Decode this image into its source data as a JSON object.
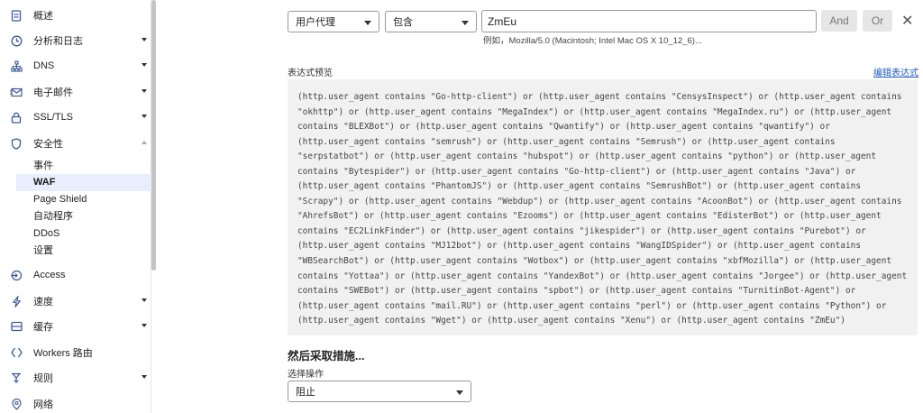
{
  "sidebar": {
    "items": [
      {
        "label": "概述",
        "icon": "document-icon"
      },
      {
        "label": "分析和日志",
        "icon": "clock-icon"
      },
      {
        "label": "DNS",
        "icon": "network-icon"
      },
      {
        "label": "电子邮件",
        "icon": "email-icon"
      },
      {
        "label": "SSL/TLS",
        "icon": "lock-icon"
      },
      {
        "label": "安全性",
        "icon": "shield-icon"
      },
      {
        "label": "Access",
        "icon": "access-icon"
      },
      {
        "label": "速度",
        "icon": "lightning-icon"
      },
      {
        "label": "缓存",
        "icon": "storage-icon"
      },
      {
        "label": "Workers 路由",
        "icon": "workers-icon"
      },
      {
        "label": "规则",
        "icon": "rules-icon"
      },
      {
        "label": "网络",
        "icon": "location-icon"
      }
    ],
    "security_sub": [
      "事件",
      "WAF",
      "Page Shield",
      "自动程序",
      "DDoS",
      "设置"
    ]
  },
  "rule": {
    "field": "用户代理",
    "operator": "包含",
    "value": "ZmEu",
    "and_label": "And",
    "or_label": "Or",
    "close_symbol": "✕",
    "example": "例如，Mozilla/5.0 (Macintosh; Intel Mac OS X 10_12_6)..."
  },
  "preview": {
    "label": "表达式预览",
    "edit_link": "编辑表达式",
    "expression": "(http.user_agent contains \"Go-http-client\") or (http.user_agent contains \"CensysInspect\") or (http.user_agent contains \"okhttp\") or (http.user_agent contains \"MegaIndex\") or (http.user_agent contains \"MegaIndex.ru\") or (http.user_agent contains \"BLEXBot\") or (http.user_agent contains \"Qwantify\") or (http.user_agent contains \"qwantify\") or (http.user_agent contains \"semrush\") or (http.user_agent contains \"Semrush\") or (http.user_agent contains \"serpstatbot\") or (http.user_agent contains \"hubspot\") or (http.user_agent contains \"python\") or (http.user_agent contains \"Bytespider\") or (http.user_agent contains \"Go-http-client\") or (http.user_agent contains \"Java\") or (http.user_agent contains \"PhantomJS\") or (http.user_agent contains \"SemrushBot\") or (http.user_agent contains \"Scrapy\") or (http.user_agent contains \"Webdup\") or (http.user_agent contains \"AcoonBot\") or (http.user_agent contains \"AhrefsBot\") or (http.user_agent contains \"Ezooms\") or (http.user_agent contains \"EdisterBot\") or (http.user_agent contains \"EC2LinkFinder\") or (http.user_agent contains \"jikespider\") or (http.user_agent contains \"Purebot\") or (http.user_agent contains \"MJ12bot\") or (http.user_agent contains \"WangIDSpider\") or (http.user_agent contains \"WBSearchBot\") or (http.user_agent contains \"Wotbox\") or (http.user_agent contains \"xbfMozilla\") or (http.user_agent contains \"Yottaa\") or (http.user_agent contains \"YandexBot\") or (http.user_agent contains \"Jorgee\") or (http.user_agent contains \"SWEBot\") or (http.user_agent contains \"spbot\") or (http.user_agent contains \"TurnitinBot-Agent\") or (http.user_agent contains \"mail.RU\") or (http.user_agent contains \"perl\") or (http.user_agent contains \"Python\") or (http.user_agent contains \"Wget\") or (http.user_agent contains \"Xenu\") or (http.user_agent contains \"ZmEu\")"
  },
  "action": {
    "title": "然后采取措施...",
    "label": "选择操作",
    "value": "阻止"
  }
}
